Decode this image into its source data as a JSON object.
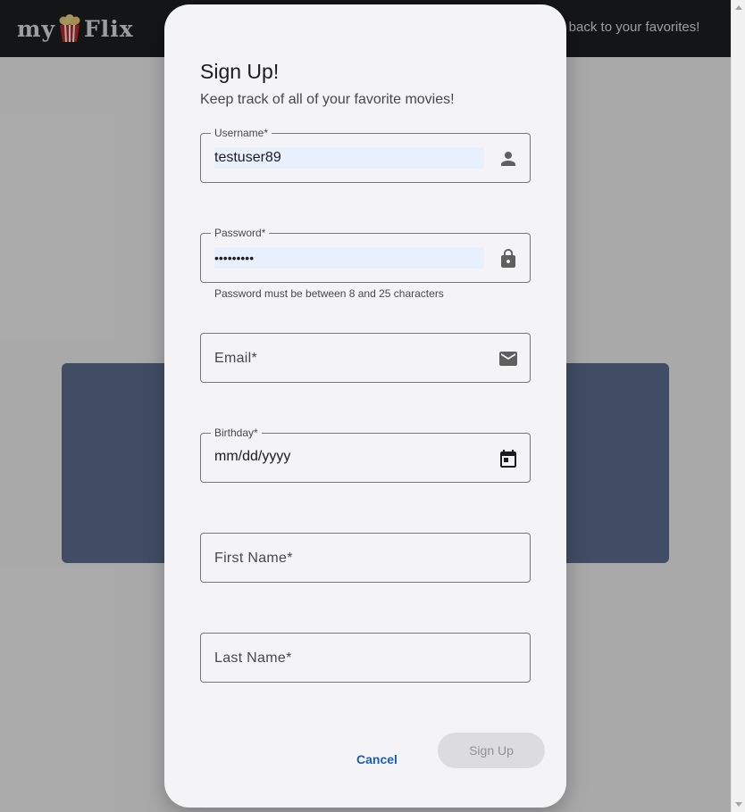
{
  "header": {
    "logo_left": "my",
    "logo_right": "Flix",
    "tagline": "et back to your favorites!"
  },
  "dialog": {
    "title": "Sign Up!",
    "subtitle": "Keep track of all of your favorite movies!",
    "fields": {
      "username": {
        "label": "Username*",
        "value": "testuser89",
        "icon": "person-icon"
      },
      "password": {
        "label": "Password*",
        "value": "•••••••••",
        "icon": "lock-icon",
        "helper": "Password must be between 8 and 25 characters"
      },
      "email": {
        "placeholder": "Email*",
        "icon": "mail-icon"
      },
      "birthday": {
        "label": "Birthday*",
        "value": "mm/dd/yyyy",
        "icon": "calendar-icon"
      },
      "first_name": {
        "placeholder": "First Name*"
      },
      "last_name": {
        "placeholder": "Last Name*"
      }
    },
    "actions": {
      "cancel": "Cancel",
      "signup": "Sign Up"
    }
  },
  "colors": {
    "accent": "#1a5fb4",
    "autofill": "#e8f0fe",
    "background_card": "#5f7295",
    "topbar": "#1c1f22"
  }
}
